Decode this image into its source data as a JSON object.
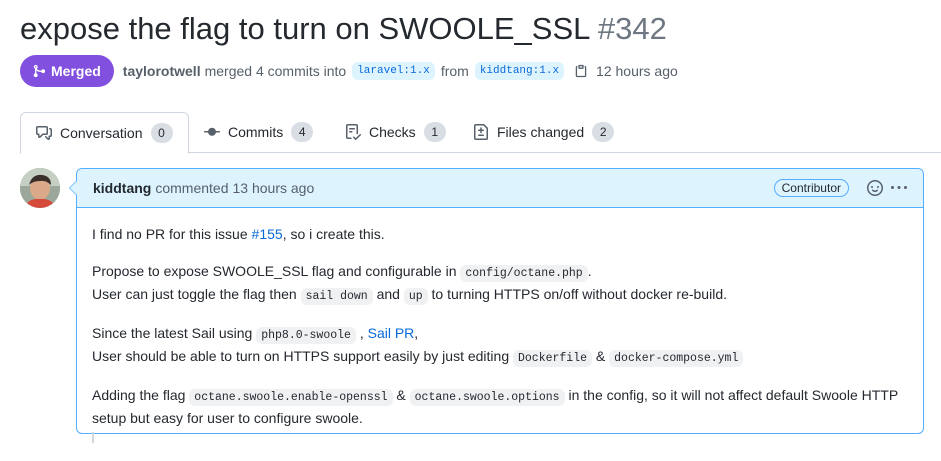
{
  "header": {
    "title": "expose the flag to turn on SWOOLE_SSL",
    "number": "#342"
  },
  "meta": {
    "state_label": "Merged",
    "author": "taylorotwell",
    "action": "merged 4 commits into",
    "base_branch": "laravel:1.x",
    "from_word": "from",
    "head_branch": "kiddtang:1.x",
    "time": "12 hours ago",
    "state_color": "#8250df"
  },
  "tabs": [
    {
      "label": "Conversation",
      "count": "0",
      "icon": "comment-discussion-icon"
    },
    {
      "label": "Commits",
      "count": "4",
      "icon": "git-commit-icon"
    },
    {
      "label": "Checks",
      "count": "1",
      "icon": "checklist-icon"
    },
    {
      "label": "Files changed",
      "count": "2",
      "icon": "file-diff-icon"
    }
  ],
  "comment": {
    "author": "kiddtang",
    "action": "commented",
    "time": "13 hours ago",
    "role": "Contributor",
    "p1": {
      "t1": "I find no PR for this issue ",
      "link": "#155",
      "t2": ", so i create this."
    },
    "p2": {
      "t1": "Propose to expose SWOOLE_SSL flag and configurable in ",
      "c1": "config/octane.php",
      "t2": ".",
      "t3": "User can just toggle the flag then ",
      "c2": "sail down",
      "t4": " and ",
      "c3": "up",
      "t5": " to turning HTTPS on/off without docker re-build."
    },
    "p3": {
      "t1": "Since the latest Sail using ",
      "c1": "php8.0-swoole",
      "t2": " , ",
      "link": "Sail PR",
      "t3": ",",
      "t4": "User should be able to turn on HTTPS support easily by just editing ",
      "c2": "Dockerfile",
      "t5": " & ",
      "c3": "docker-compose.yml"
    },
    "p4": {
      "t1": "Adding the flag ",
      "c1": "octane.swoole.enable-openssl",
      "t2": " & ",
      "c2": "octane.swoole.options",
      "t3": " in the config, so it will not affect default Swoole HTTP setup but easy for user to configure swoole."
    }
  }
}
